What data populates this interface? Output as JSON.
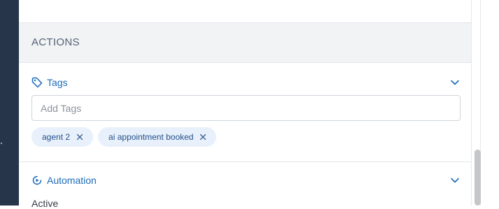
{
  "actions": {
    "title": "ACTIONS"
  },
  "tags": {
    "label": "Tags",
    "icon": "tag-icon",
    "input_placeholder": "Add Tags",
    "chips": [
      {
        "label": "agent 2"
      },
      {
        "label": "ai appointment booked"
      }
    ]
  },
  "automation": {
    "label": "Automation",
    "icon": "automation-icon",
    "status": "Active"
  },
  "colors": {
    "accent": "#1b6bb8",
    "chip_bg": "#e8f1fb",
    "rail": "#26354a",
    "section_bg": "#f1f3f5"
  }
}
